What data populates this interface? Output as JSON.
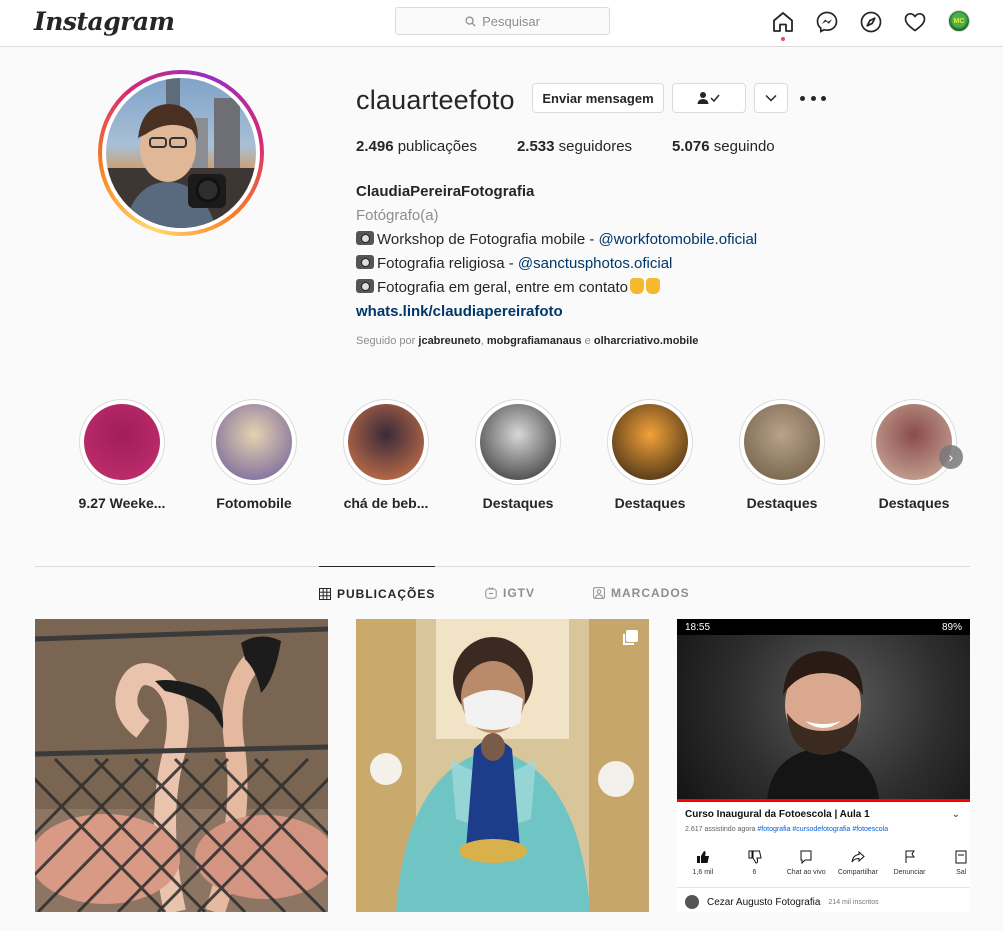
{
  "nav": {
    "logo": "Instagram",
    "search_placeholder": "Pesquisar",
    "icons": [
      "home-icon",
      "messenger-icon",
      "explore-icon",
      "activity-heart-icon",
      "profile-avatar"
    ],
    "avatar_text": "MC",
    "accent_color": "#ed4956"
  },
  "profile": {
    "username": "clauarteefoto",
    "buttons": {
      "message": "Enviar mensagem"
    },
    "stats": [
      {
        "count": "2.496",
        "label": "publicações"
      },
      {
        "count": "2.533",
        "label": "seguidores"
      },
      {
        "count": "5.076",
        "label": "seguindo"
      }
    ],
    "full_name": "ClaudiaPereiraFotografia",
    "category": "Fotógrafo(a)",
    "bio_lines": [
      {
        "text": "Workshop de Fotografia mobile - ",
        "mention": "@workfotomobile.oficial"
      },
      {
        "text": "Fotografia religiosa - ",
        "mention": "@sanctusphotos.oficial"
      },
      {
        "text": "Fotografia em geral, entre em contato",
        "mention": ""
      }
    ],
    "link": "whats.link/claudiapereirafoto",
    "followed_by_prefix": "Seguido por ",
    "followed_by": [
      "jcabreuneto",
      "mobgrafiamanaus",
      "olharcriativo.mobile"
    ],
    "followed_by_sep": ", ",
    "followed_by_and": " e "
  },
  "highlights": [
    {
      "label": "9.27 Weeke...",
      "colors": [
        "#a01d5a",
        "#c4306f"
      ]
    },
    {
      "label": "Fotomobile",
      "colors": [
        "#e6d2b0",
        "#6a5a9a"
      ]
    },
    {
      "label": "chá de beb...",
      "colors": [
        "#3b2a3a",
        "#d77a4a"
      ]
    },
    {
      "label": "Destaques",
      "colors": [
        "#d8d8d8",
        "#2b2b2b"
      ]
    },
    {
      "label": "Destaques",
      "colors": [
        "#f2a23a",
        "#2e2010"
      ]
    },
    {
      "label": "Destaques",
      "colors": [
        "#b9a389",
        "#6b5a44"
      ]
    },
    {
      "label": "Destaques",
      "colors": [
        "#8a4c4c",
        "#d0b2a0"
      ]
    }
  ],
  "tabs": [
    {
      "label": "PUBLICAÇÕES",
      "icon": "grid-icon",
      "active": true
    },
    {
      "label": "IGTV",
      "icon": "igtv-icon",
      "active": false
    },
    {
      "label": "MARCADOS",
      "icon": "tagged-icon",
      "active": false
    }
  ],
  "posts": {
    "youtube_screenshot": {
      "time": "18:55",
      "battery": "89%",
      "title": "Curso Inaugural da Fotoescola | Aula 1",
      "meta": "2.617 assistindo agora",
      "tags": "#fotografia #cursodefotografia #fotoescola",
      "actions": [
        {
          "label": "1,6 mil",
          "icon": "like-icon"
        },
        {
          "label": "6",
          "icon": "dislike-icon"
        },
        {
          "label": "Chat ao vivo",
          "icon": "chat-icon"
        },
        {
          "label": "Compartilhar",
          "icon": "share-icon"
        },
        {
          "label": "Denunciar",
          "icon": "flag-icon"
        },
        {
          "label": "Sal",
          "icon": "save-icon"
        }
      ],
      "channel": "Cezar Augusto Fotografia",
      "subscribers": "214 mil inscritos"
    }
  }
}
